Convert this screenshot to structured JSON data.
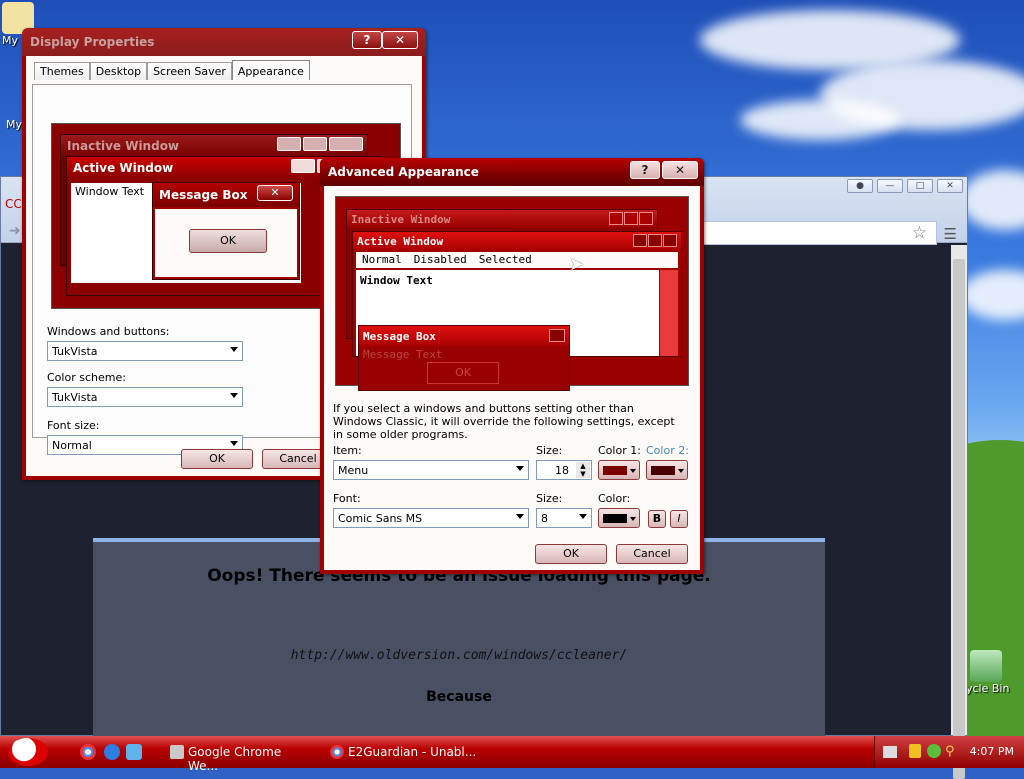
{
  "desktop": {
    "icons": [
      {
        "label": "My",
        "name": "my-documents"
      },
      {
        "label": "My",
        "name": "my-computer"
      },
      {
        "label": "ycle Bin",
        "name": "recycle-bin"
      }
    ]
  },
  "chrome": {
    "tab_fragment": "CC",
    "error_title": "Oops! There seems to be an issue loading this page.",
    "error_url": "http://www.oldversion.com/windows/ccleaner/",
    "error_because": "Because"
  },
  "display_properties": {
    "title": "Display Properties",
    "tabs": [
      "Themes",
      "Desktop",
      "Screen Saver",
      "Appearance"
    ],
    "active_tab": "Appearance",
    "preview": {
      "inactive_title": "Inactive Window",
      "active_title": "Active Window",
      "window_text": "Window Text",
      "message_box_title": "Message Box",
      "ok_label": "OK"
    },
    "windows_buttons_label": "Windows and buttons:",
    "windows_buttons_value": "TukVista",
    "color_scheme_label": "Color scheme:",
    "color_scheme_value": "TukVista",
    "font_size_label": "Font size:",
    "font_size_value": "Normal",
    "ok_label": "OK",
    "cancel_label": "Cancel"
  },
  "advanced": {
    "title": "Advanced Appearance",
    "preview": {
      "inactive_title": "Inactive Window",
      "active_title": "Active Window",
      "menu_items": [
        "Normal",
        "Disabled",
        "Selected"
      ],
      "window_text": "Window Text",
      "message_box_title": "Message Box",
      "message_text": "Message Text",
      "ok_label": "OK"
    },
    "info_text": "If you select a windows and buttons setting other than Windows Classic, it will override the following settings, except in some older programs.",
    "item_label": "Item:",
    "item_value": "Menu",
    "size_label": "Size:",
    "size_value": "18",
    "color1_label": "Color 1:",
    "color2_label": "Color 2:",
    "font_label": "Font:",
    "font_value": "Comic Sans MS",
    "font_size_label": "Size:",
    "font_size_value": "8",
    "color_label": "Color:",
    "bold_label": "B",
    "italic_label": "I",
    "ok_label": "OK",
    "cancel_label": "Cancel"
  },
  "taskbar": {
    "tasks": [
      "Google Chrome We...",
      "E2Guardian - Unabl..."
    ],
    "clock": "4:07 PM"
  },
  "colors": {
    "title_red": "#9b0000",
    "taskbar_red": "#b80000",
    "preview_red": "#8a0000"
  }
}
